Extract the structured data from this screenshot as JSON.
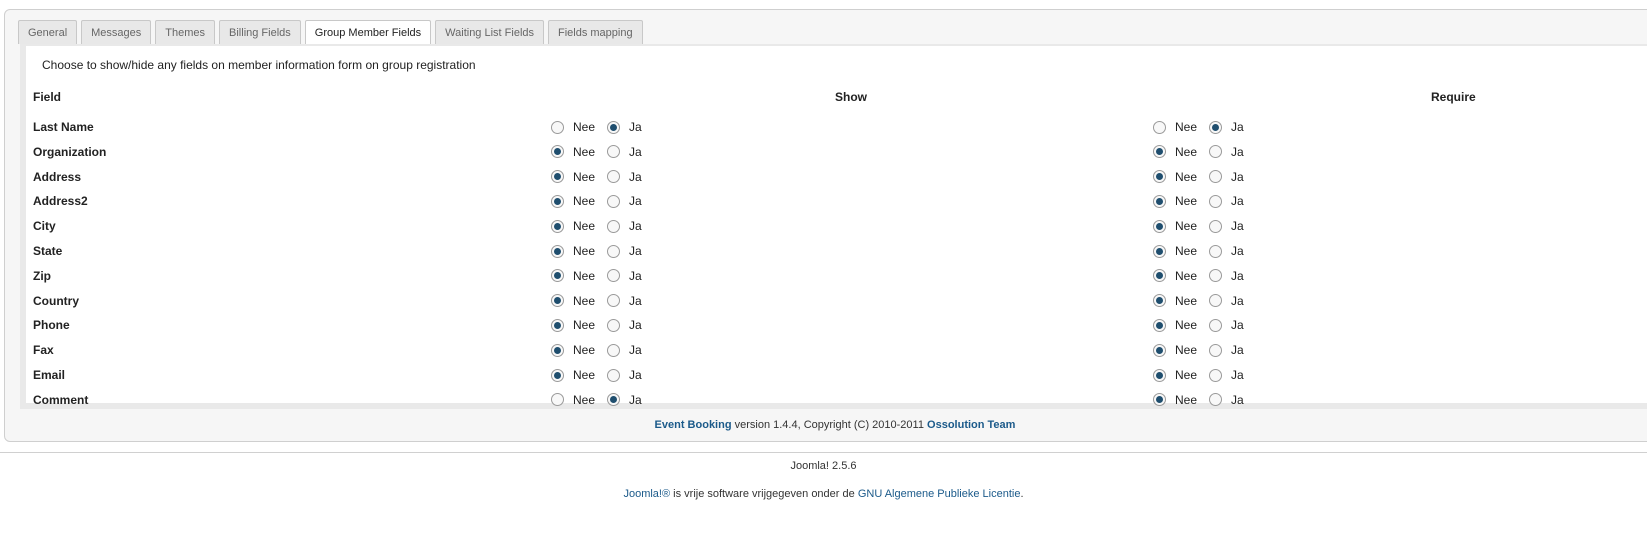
{
  "tabs": [
    {
      "label": "General",
      "active": false
    },
    {
      "label": "Messages",
      "active": false
    },
    {
      "label": "Themes",
      "active": false
    },
    {
      "label": "Billing Fields",
      "active": false
    },
    {
      "label": "Group Member Fields",
      "active": true
    },
    {
      "label": "Waiting List Fields",
      "active": false
    },
    {
      "label": "Fields mapping",
      "active": false
    }
  ],
  "panel": {
    "description": "Choose to show/hide any fields on member information form on group registration",
    "headers": {
      "field": "Field",
      "show": "Show",
      "require": "Require"
    },
    "option_no": "Nee",
    "option_yes": "Ja",
    "rows": [
      {
        "label": "Last Name",
        "show": "Ja",
        "require": "Ja"
      },
      {
        "label": "Organization",
        "show": "Nee",
        "require": "Nee"
      },
      {
        "label": "Address",
        "show": "Nee",
        "require": "Nee"
      },
      {
        "label": "Address2",
        "show": "Nee",
        "require": "Nee"
      },
      {
        "label": "City",
        "show": "Nee",
        "require": "Nee"
      },
      {
        "label": "State",
        "show": "Nee",
        "require": "Nee"
      },
      {
        "label": "Zip",
        "show": "Nee",
        "require": "Nee"
      },
      {
        "label": "Country",
        "show": "Nee",
        "require": "Nee"
      },
      {
        "label": "Phone",
        "show": "Nee",
        "require": "Nee"
      },
      {
        "label": "Fax",
        "show": "Nee",
        "require": "Nee"
      },
      {
        "label": "Email",
        "show": "Nee",
        "require": "Nee"
      },
      {
        "label": "Comment",
        "show": "Ja",
        "require": "Nee"
      }
    ]
  },
  "copyright": {
    "product_link": "Event Booking",
    "text": " version 1.4.4, Copyright (C) 2010-2011 ",
    "team_link": "Ossolution Team"
  },
  "footer": {
    "version": "Joomla! 2.5.6",
    "joomla_link": "Joomla!®",
    "license_text": " is vrije software vrijgegeven onder de ",
    "license_link": "GNU Algemene Publieke Licentie",
    "period": "."
  }
}
